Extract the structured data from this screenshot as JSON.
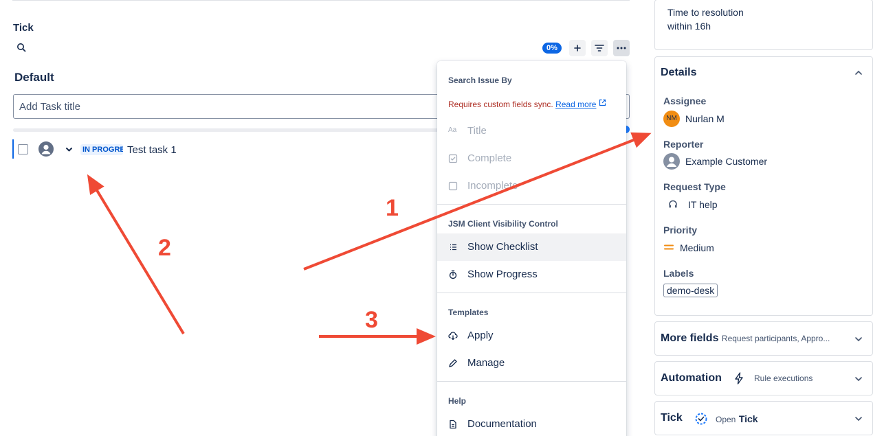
{
  "left": {
    "section_title": "Tick",
    "progress_badge": "0%",
    "group_title": "Default",
    "task_input_placeholder": "Add Task title",
    "task": {
      "status": "IN PROGRESS",
      "title": "Test task 1"
    }
  },
  "menu": {
    "search_header": "Search Issue By",
    "sync_note": "Requires custom fields sync.",
    "read_more": "Read more",
    "search_items": [
      "Title",
      "Complete",
      "Incomplete"
    ],
    "visibility_header": "JSM Client Visibility Control",
    "visibility_items": [
      "Show Checklist",
      "Show Progress"
    ],
    "templates_header": "Templates",
    "templates_items": [
      "Apply",
      "Manage"
    ],
    "help_header": "Help",
    "help_items": [
      "Documentation"
    ]
  },
  "right": {
    "sla": {
      "label": "Time to resolution",
      "value": "within 16h"
    },
    "details": {
      "title": "Details",
      "assignee_label": "Assignee",
      "assignee_initials": "NM",
      "assignee": "Nurlan M",
      "reporter_label": "Reporter",
      "reporter": "Example Customer",
      "request_type_label": "Request Type",
      "request_type": "IT help",
      "priority_label": "Priority",
      "priority": "Medium",
      "labels_label": "Labels",
      "labels": [
        "demo-desk"
      ]
    },
    "more_fields": {
      "title": "More fields",
      "subtitle": "Request participants, Appro..."
    },
    "automation": {
      "title": "Automation",
      "subtitle": "Rule executions"
    },
    "tick": {
      "title": "Tick",
      "open_prefix": "Open",
      "open_app": "Tick"
    }
  },
  "annotations": [
    "1",
    "2",
    "3"
  ],
  "colors": {
    "accent": "#0c66e4",
    "annotation": "#ef4a35",
    "priority_medium": "#f18d13",
    "assignee_avatar": "#f18d13"
  }
}
